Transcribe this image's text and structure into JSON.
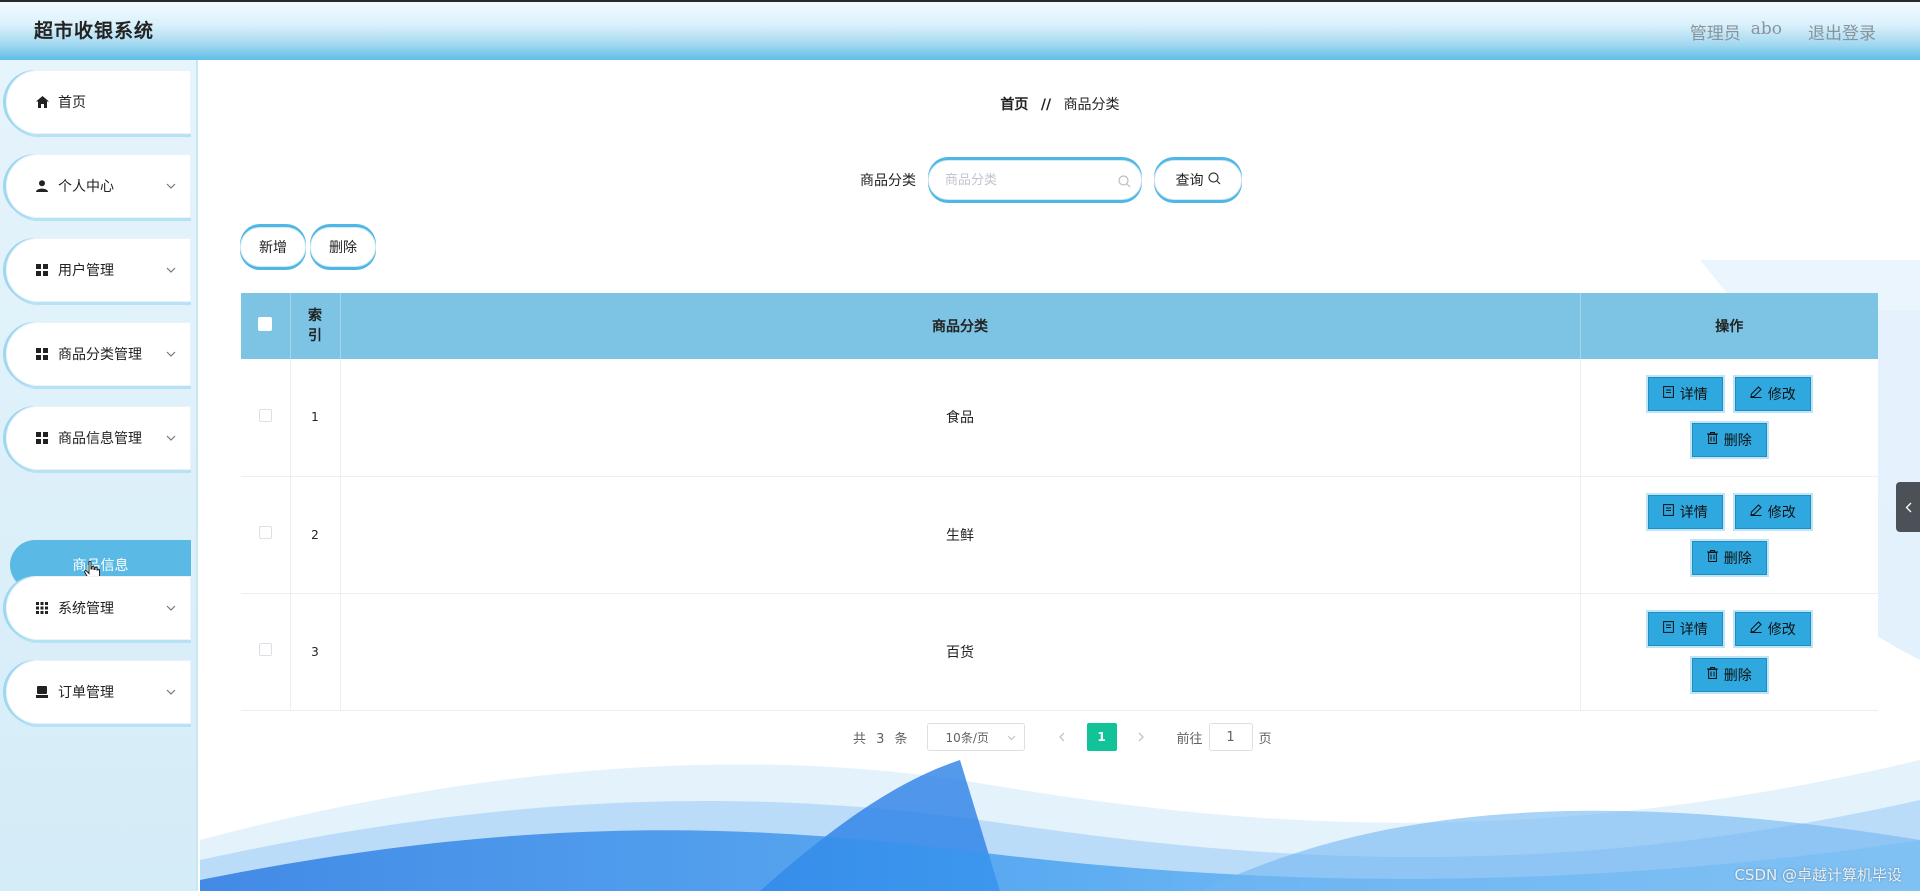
{
  "header": {
    "title": "超市收银系统",
    "role": "管理员",
    "username": "abo",
    "logout": "退出登录"
  },
  "sidebar": {
    "items": [
      {
        "label": "首页",
        "icon": "home-icon"
      },
      {
        "label": "个人中心",
        "icon": "user-icon"
      },
      {
        "label": "用户管理",
        "icon": "grid-icon"
      },
      {
        "label": "商品分类管理",
        "icon": "grid-icon"
      },
      {
        "label": "商品信息管理",
        "icon": "grid-icon"
      },
      {
        "label": "系统管理",
        "icon": "apps-icon"
      },
      {
        "label": "订单管理",
        "icon": "printer-icon"
      }
    ],
    "submenu": {
      "label": "商品信息"
    }
  },
  "breadcrumb": {
    "home": "首页",
    "separator": "//",
    "current": "商品分类"
  },
  "search": {
    "label": "商品分类",
    "placeholder": "商品分类",
    "button": "查询"
  },
  "actions": {
    "add": "新增",
    "delete": "删除"
  },
  "table": {
    "headers": {
      "index": "索\n引",
      "category": "商品分类",
      "operations": "操作"
    },
    "rows": [
      {
        "index": "1",
        "category": "食品"
      },
      {
        "index": "2",
        "category": "生鲜"
      },
      {
        "index": "3",
        "category": "百货"
      }
    ],
    "buttons": {
      "detail": "详情",
      "edit": "修改",
      "delete": "删除"
    }
  },
  "pagination": {
    "total": "共 3 条",
    "page_size": "10条/页",
    "current_page": "1",
    "goto_label": "前往",
    "goto_value": "1",
    "page_unit": "页"
  },
  "watermark": "CSDN @卓越计算机毕设",
  "colors": {
    "accent": "#4fb7e6",
    "table_header": "#7cc3e4",
    "op_button": "#2ea8df",
    "active_page": "#12c39a",
    "submenu_active": "#5ab9e5"
  }
}
